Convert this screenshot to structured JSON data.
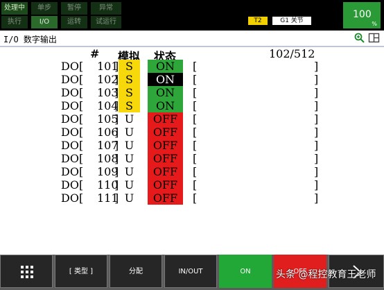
{
  "status_buttons": [
    {
      "label": "处理中"
    },
    {
      "label": "单步"
    },
    {
      "label": "暂停"
    },
    {
      "label": "异常"
    },
    {
      "label": "执行"
    },
    {
      "label": "I/O"
    },
    {
      "label": "运转"
    },
    {
      "label": "试运行"
    }
  ],
  "status": {
    "mode": "T2",
    "group_label": "G1 关节",
    "override": "100",
    "override_unit": "%"
  },
  "screen": {
    "title": "I/O 数字输出",
    "zoom_icon": "zoom-icon",
    "layout_icon": "window-layout-icon"
  },
  "table": {
    "header_num": "#",
    "header_sim": "模拟",
    "header_status": "状态",
    "page_range": "102/512",
    "rows": [
      {
        "label": "DO[",
        "num": "101",
        "sim": "S",
        "status": "ON"
      },
      {
        "label": "DO[",
        "num": "102",
        "sim": "S",
        "status": "ON"
      },
      {
        "label": "DO[",
        "num": "103",
        "sim": "S",
        "status": "ON"
      },
      {
        "label": "DO[",
        "num": "104",
        "sim": "S",
        "status": "ON"
      },
      {
        "label": "DO[",
        "num": "105",
        "sim": "U",
        "status": "OFF"
      },
      {
        "label": "DO[",
        "num": "106",
        "sim": "U",
        "status": "OFF"
      },
      {
        "label": "DO[",
        "num": "107",
        "sim": "U",
        "status": "OFF"
      },
      {
        "label": "DO[",
        "num": "108",
        "sim": "U",
        "status": "OFF"
      },
      {
        "label": "DO[",
        "num": "109",
        "sim": "U",
        "status": "OFF"
      },
      {
        "label": "DO[",
        "num": "110",
        "sim": "U",
        "status": "OFF"
      },
      {
        "label": "DO[",
        "num": "111",
        "sim": "U",
        "status": "OFF"
      }
    ]
  },
  "function_keys": {
    "menu_icon": "grid-menu-icon",
    "type": "[ 类型 ]",
    "assign": "分配",
    "in_out": "IN/OUT",
    "on": "ON",
    "off": "OFF",
    "next_icon": "chevron-right-icon"
  },
  "watermark": "头条 @程控教育王老师",
  "colors": {
    "on_green": "#2ea63a",
    "off_red": "#e61a1a",
    "sim_yellow": "#f6d80b",
    "override_green": "#2a9a36"
  }
}
